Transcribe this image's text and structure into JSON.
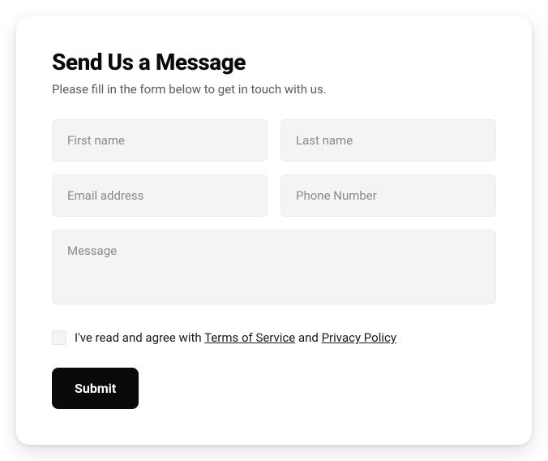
{
  "heading": "Send Us a Message",
  "subheading": "Please fill in the form below to get in touch with us.",
  "fields": {
    "first_name": {
      "placeholder": "First name",
      "value": ""
    },
    "last_name": {
      "placeholder": "Last name",
      "value": ""
    },
    "email": {
      "placeholder": "Email address",
      "value": ""
    },
    "phone": {
      "placeholder": "Phone Number",
      "value": ""
    },
    "message": {
      "placeholder": "Message",
      "value": ""
    }
  },
  "consent": {
    "checked": false,
    "prefix": "I've read and agree with ",
    "tos_label": "Terms of Service",
    "middle": " and ",
    "privacy_label": "Privacy Policy"
  },
  "submit_label": "Submit"
}
